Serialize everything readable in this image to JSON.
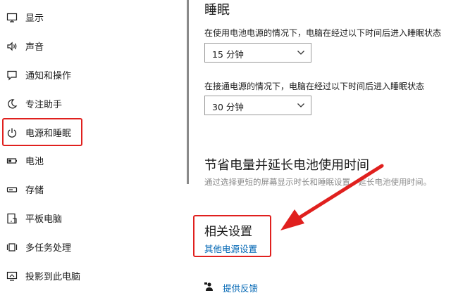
{
  "sidebar": {
    "items": [
      {
        "label": "显示",
        "icon": "display-icon"
      },
      {
        "label": "声音",
        "icon": "speaker-icon"
      },
      {
        "label": "通知和操作",
        "icon": "notification-icon"
      },
      {
        "label": "专注助手",
        "icon": "moon-icon"
      },
      {
        "label": "电源和睡眠",
        "icon": "power-icon"
      },
      {
        "label": "电池",
        "icon": "battery-icon"
      },
      {
        "label": "存储",
        "icon": "storage-icon"
      },
      {
        "label": "平板电脑",
        "icon": "tablet-icon"
      },
      {
        "label": "多任务处理",
        "icon": "multitask-icon"
      },
      {
        "label": "投影到此电脑",
        "icon": "project-icon"
      }
    ],
    "selected": "电源和睡眠"
  },
  "sleep": {
    "heading": "睡眠",
    "battery_desc": "在使用电池电源的情况下，电脑在经过以下时间后进入睡眠状态",
    "battery_value": "15 分钟",
    "plugged_desc": "在接通电源的情况下，电脑在经过以下时间后进入睡眠状态",
    "plugged_value": "30 分钟"
  },
  "save": {
    "heading": "节省电量并延长电池使用时间",
    "desc": "通过选择更短的屏幕显示时长和睡眠设置，延长电池使用时间。"
  },
  "related": {
    "heading": "相关设置",
    "link": "其他电源设置"
  },
  "feedback": {
    "link": "提供反馈",
    "icon": "feedback-icon"
  },
  "colors": {
    "highlight": "#e0201e",
    "link": "#0066b4"
  }
}
